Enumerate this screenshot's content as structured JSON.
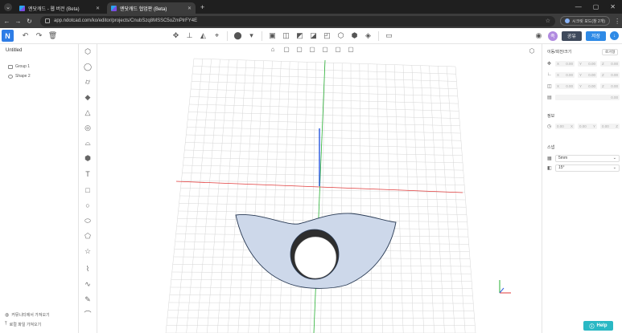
{
  "browser": {
    "tabs": [
      {
        "label": "엔닷캐드 - 웹 버전 (Beta)",
        "active": false
      },
      {
        "label": "엔닷캐드 협업판 (Beta)",
        "active": true
      }
    ],
    "url": "app.ndotcad.com/ko/editor/projects/CnubSzq8MSSC5oZmPlrFY4E",
    "profile_label": "시크릿 모드(창 2개)"
  },
  "toolbar": {
    "logo": "N",
    "avatar_initial": "족",
    "share_label": "공유",
    "save_label": "저장"
  },
  "left_panel": {
    "doc_title": "Untitled",
    "tree": [
      {
        "label": "Group 1",
        "icon": "folder-icon"
      },
      {
        "label": "Shape 2",
        "icon": "shape-icon"
      }
    ],
    "footer": [
      {
        "label": "커뮤니티에서 가져오기",
        "icon": "community-icon"
      },
      {
        "label": "로컬 파일 가져오기",
        "icon": "upload-icon"
      }
    ]
  },
  "right_panel": {
    "transform_title": "이동/회전/크기",
    "unit_toggle": "로거형",
    "pos_fields": [
      [
        "X",
        "0.00"
      ],
      [
        "Y",
        "0.00"
      ],
      [
        "Z",
        "0.00"
      ]
    ],
    "rot_fields": [
      [
        "X",
        "0.00"
      ],
      [
        "Y",
        "0.00"
      ],
      [
        "Z",
        "0.00"
      ]
    ],
    "scale_fields": [
      [
        "X",
        "0.00"
      ],
      [
        "Y",
        "0.00"
      ],
      [
        "Z",
        "0.00"
      ]
    ],
    "extra_value": "0.00",
    "grid_title": "정보",
    "grid_fields": [
      [
        "0.00",
        "X"
      ],
      [
        "0.00",
        "Y"
      ],
      [
        "0.00",
        "Z"
      ]
    ],
    "snap_title": "스냅",
    "snap_size": "5mm",
    "snap_angle": "15°",
    "help_label": "Help"
  },
  "colors": {
    "accent": "#2e8ae6",
    "shape_fill": "#cdd8ea",
    "x_axis": "#e03a3a",
    "y_axis": "#27b033",
    "z_axis": "#3360e0",
    "help": "#2ab8c4"
  }
}
